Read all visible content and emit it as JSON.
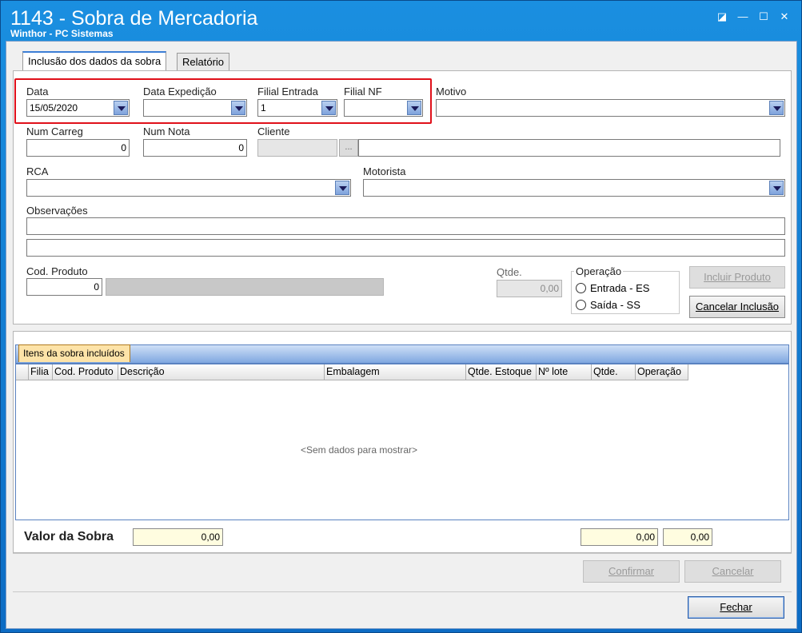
{
  "window": {
    "title": "1143 - Sobra de Mercadoria",
    "subtitle": "Winthor - PC Sistemas",
    "controls": {
      "restore": "◪",
      "minimize": "—",
      "maximize": "☐",
      "close": "✕"
    }
  },
  "tabs": [
    {
      "label": "Inclusão dos dados da sobra",
      "active": true
    },
    {
      "label": "Relatório",
      "active": false
    }
  ],
  "form": {
    "data": {
      "label": "Data",
      "value": "15/05/2020"
    },
    "data_expedicao": {
      "label": "Data Expedição",
      "value": ""
    },
    "filial_entrada": {
      "label": "Filial Entrada",
      "value": "1"
    },
    "filial_nf": {
      "label": "Filial NF",
      "value": ""
    },
    "motivo": {
      "label": "Motivo",
      "value": ""
    },
    "num_carreg": {
      "label": "Num Carreg",
      "value": "0"
    },
    "num_nota": {
      "label": "Num Nota",
      "value": "0"
    },
    "cliente": {
      "label": "Cliente",
      "code": "",
      "name": "",
      "button": "..."
    },
    "rca": {
      "label": "RCA",
      "value": ""
    },
    "motorista": {
      "label": "Motorista",
      "value": ""
    },
    "observacoes": {
      "label": "Observações",
      "line1": "",
      "line2": ""
    },
    "cod_produto": {
      "label": "Cod. Produto",
      "value": "0",
      "description": ""
    },
    "qtde": {
      "label": "Qtde.",
      "value": "0,00"
    },
    "operacao": {
      "label": "Operação",
      "options": [
        "Entrada - ES",
        "Saída - SS"
      ]
    },
    "incluir_produto": "Incluir Produto",
    "cancelar_inclusao": "Cancelar Inclusão"
  },
  "items": {
    "tab_label": "Itens da sobra incluídos",
    "columns": [
      "Filia",
      "Cod. Produto",
      "Descrição",
      "Embalagem",
      "Qtde. Estoque",
      "Nº lote",
      "Qtde.",
      "Operação"
    ],
    "empty_text": "<Sem dados para mostrar>"
  },
  "totals": {
    "label": "Valor da Sobra",
    "valor": "0,00",
    "total1": "0,00",
    "total2": "0,00"
  },
  "actions": {
    "confirmar": "Confirmar",
    "cancelar": "Cancelar",
    "fechar": "Fechar"
  },
  "colors": {
    "titlebar": "#1a8fe0",
    "highlight_box": "#e0101a",
    "yellow_field": "#fffde0"
  }
}
